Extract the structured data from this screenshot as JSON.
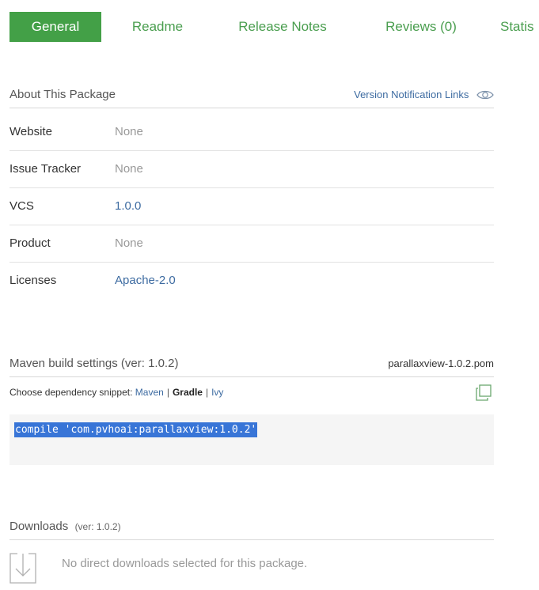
{
  "tabs": [
    {
      "label": "General",
      "active": true
    },
    {
      "label": "Readme"
    },
    {
      "label": "Release Notes"
    },
    {
      "label": "Reviews (0)"
    },
    {
      "label": "Statis"
    }
  ],
  "about": {
    "title": "About This Package",
    "notification_link": "Version Notification Links",
    "rows": [
      {
        "label": "Website",
        "value": "None"
      },
      {
        "label": "Issue Tracker",
        "value": "None"
      },
      {
        "label": "VCS",
        "value": "1.0.0"
      },
      {
        "label": "Product",
        "value": "None"
      },
      {
        "label": "Licenses",
        "value": "Apache-2.0"
      }
    ]
  },
  "maven": {
    "title": "Maven build settings (ver: 1.0.2)",
    "pom_link": "parallaxview-1.0.2.pom",
    "chooser_label": "Choose dependency snippet:",
    "options": [
      "Maven",
      "Gradle",
      "Ivy"
    ],
    "selected": "Gradle",
    "snippet": "compile 'com.pvhoai:parallaxview:1.0.2'"
  },
  "downloads": {
    "title": "Downloads",
    "version": "(ver: 1.0.2)",
    "empty_text": "No direct downloads selected for this package."
  },
  "colors": {
    "accent_green": "#43a047",
    "link_blue": "#3d6ba1",
    "selection_blue": "#3875d7"
  }
}
